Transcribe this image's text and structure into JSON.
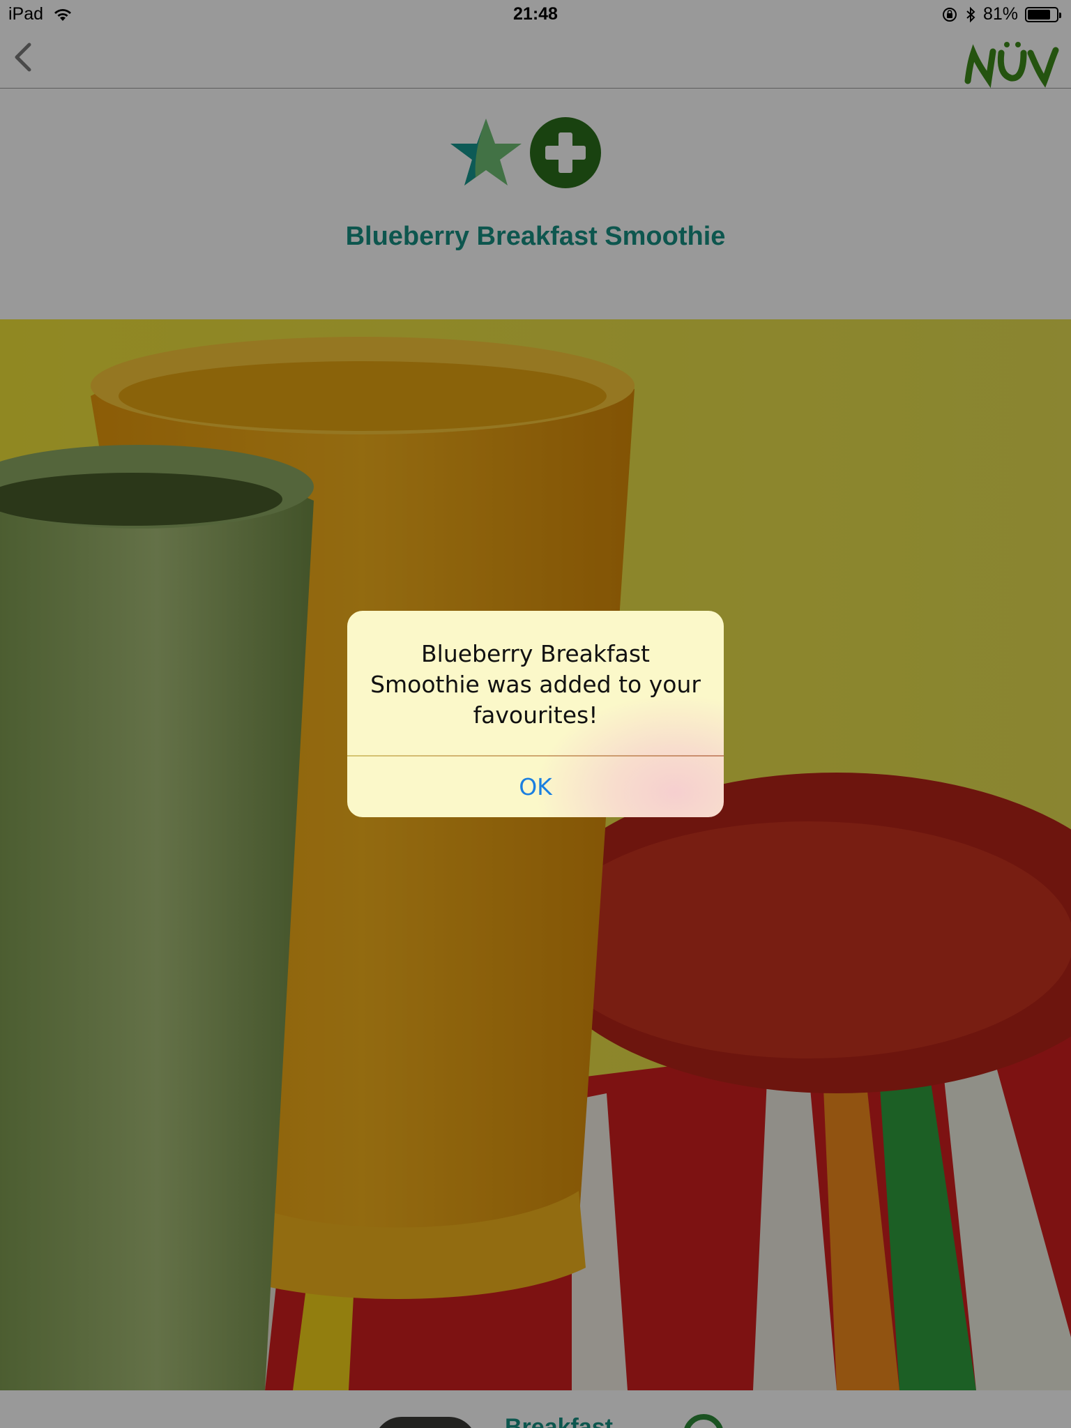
{
  "status_bar": {
    "device": "iPad",
    "time": "21:48",
    "battery_percent": "81%",
    "battery_level": 0.81
  },
  "nav": {
    "back_icon": "chevron-left-icon",
    "logo_text": "NÜV"
  },
  "recipe": {
    "title": "Blueberry Breakfast Smoothie",
    "favourite_icon": "star-icon",
    "add_icon": "plus-circle-icon",
    "category": "Breakfast"
  },
  "alert": {
    "message": "Blueberry Breakfast Smoothie was added to your favourites!",
    "ok_label": "OK"
  },
  "colors": {
    "accent_teal": "#178f83",
    "dark_green": "#2a6e1b",
    "ios_blue": "#1a7fe0"
  }
}
